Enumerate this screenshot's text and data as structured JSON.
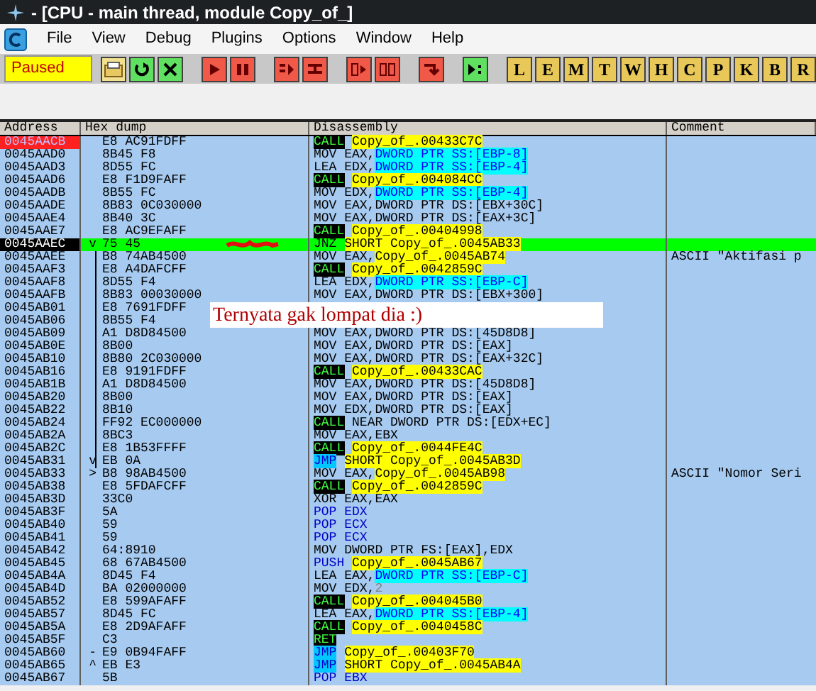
{
  "window": {
    "title": "- [CPU - main thread, module Copy_of_]"
  },
  "menu": [
    {
      "label": "File"
    },
    {
      "label": "View"
    },
    {
      "label": "Debug"
    },
    {
      "label": "Plugins"
    },
    {
      "label": "Options"
    },
    {
      "label": "Window"
    },
    {
      "label": "Help"
    }
  ],
  "toolbar": {
    "status": "Paused",
    "buttons": [
      {
        "kind": "open"
      },
      {
        "kind": "restart"
      },
      {
        "kind": "close"
      },
      {
        "kind": "run"
      },
      {
        "kind": "pause"
      },
      {
        "kind": "step_into"
      },
      {
        "kind": "step_over"
      },
      {
        "kind": "trace_into"
      },
      {
        "kind": "trace_over"
      },
      {
        "kind": "till_return"
      },
      {
        "kind": "go_to"
      },
      {
        "kind": "letter",
        "label": "L"
      },
      {
        "kind": "letter",
        "label": "E"
      },
      {
        "kind": "letter",
        "label": "M"
      },
      {
        "kind": "letter",
        "label": "T"
      },
      {
        "kind": "letter",
        "label": "W"
      },
      {
        "kind": "letter",
        "label": "H"
      },
      {
        "kind": "letter",
        "label": "C"
      },
      {
        "kind": "letter",
        "label": "P"
      },
      {
        "kind": "letter",
        "label": "K"
      },
      {
        "kind": "letter",
        "label": "B"
      },
      {
        "kind": "letter",
        "label": "R"
      }
    ]
  },
  "table": {
    "columns": [
      "Address",
      "Hex dump",
      "Disassembly",
      "Comment"
    ],
    "rows": [
      {
        "address": "0045AACB",
        "hex": "E8 AC91FDFF",
        "breakpoint": true,
        "selected": false,
        "op": {
          "text": "CALL",
          "kind": "call"
        },
        "args": [
          {
            "text": "Copy_of_.00433C7C",
            "kind": "target"
          }
        ]
      },
      {
        "address": "0045AAD0",
        "hex": "8B45 F8",
        "breakpoint": false,
        "selected": false,
        "op": {
          "text": "MOV",
          "kind": "plain"
        },
        "args": [
          {
            "text": "EAX,",
            "kind": "plain"
          },
          {
            "text": "DWORD PTR SS:[EBP-8]",
            "kind": "mem"
          }
        ]
      },
      {
        "address": "0045AAD3",
        "hex": "8D55 FC",
        "breakpoint": false,
        "selected": false,
        "op": {
          "text": "LEA",
          "kind": "plain"
        },
        "args": [
          {
            "text": "EDX,",
            "kind": "plain"
          },
          {
            "text": "DWORD PTR SS:[EBP-4]",
            "kind": "mem"
          }
        ]
      },
      {
        "address": "0045AAD6",
        "hex": "E8 F1D9FAFF",
        "breakpoint": false,
        "selected": false,
        "op": {
          "text": "CALL",
          "kind": "call"
        },
        "args": [
          {
            "text": "Copy_of_.004084CC",
            "kind": "target"
          }
        ]
      },
      {
        "address": "0045AADB",
        "hex": "8B55 FC",
        "breakpoint": false,
        "selected": false,
        "op": {
          "text": "MOV",
          "kind": "plain"
        },
        "args": [
          {
            "text": "EDX,",
            "kind": "plain"
          },
          {
            "text": "DWORD PTR SS:[EBP-4]",
            "kind": "mem"
          }
        ]
      },
      {
        "address": "0045AADE",
        "hex": "8B83 0C030000",
        "breakpoint": false,
        "selected": false,
        "op": {
          "text": "MOV",
          "kind": "plain"
        },
        "args": [
          {
            "text": "EAX,DWORD PTR DS:[EBX+30C]",
            "kind": "plain"
          }
        ]
      },
      {
        "address": "0045AAE4",
        "hex": "8B40 3C",
        "breakpoint": false,
        "selected": false,
        "op": {
          "text": "MOV",
          "kind": "plain"
        },
        "args": [
          {
            "text": "EAX,DWORD PTR DS:[EAX+3C]",
            "kind": "plain"
          }
        ]
      },
      {
        "address": "0045AAE7",
        "hex": "E8 AC9EFAFF",
        "breakpoint": false,
        "selected": false,
        "op": {
          "text": "CALL",
          "kind": "call"
        },
        "args": [
          {
            "text": "Copy_of_.00404998",
            "kind": "target"
          }
        ]
      },
      {
        "address": "0045AAEC",
        "hex": "75 45",
        "jump": "v",
        "breakpoint": false,
        "selected": true,
        "op": {
          "text": "JNZ",
          "kind": "plain"
        },
        "args": [
          {
            "text": "SHORT Copy_of_.0045AB33",
            "kind": "target"
          }
        ]
      },
      {
        "address": "0045AAEE",
        "hex": "B8 74AB4500",
        "jump_line": true,
        "breakpoint": false,
        "selected": false,
        "op": {
          "text": "MOV",
          "kind": "plain"
        },
        "args": [
          {
            "text": "EAX,",
            "kind": "plain"
          },
          {
            "text": "Copy_of_.0045AB74",
            "kind": "target"
          }
        ],
        "comment": "ASCII \"Aktifasi p"
      },
      {
        "address": "0045AAF3",
        "hex": "E8 A4DAFCFF",
        "jump_line": true,
        "breakpoint": false,
        "selected": false,
        "op": {
          "text": "CALL",
          "kind": "call"
        },
        "args": [
          {
            "text": "Copy_of_.0042859C",
            "kind": "target"
          }
        ]
      },
      {
        "address": "0045AAF8",
        "hex": "8D55 F4",
        "jump_line": true,
        "breakpoint": false,
        "selected": false,
        "op": {
          "text": "LEA",
          "kind": "plain"
        },
        "args": [
          {
            "text": "EDX,",
            "kind": "plain"
          },
          {
            "text": "DWORD PTR SS:[EBP-C]",
            "kind": "mem"
          }
        ]
      },
      {
        "address": "0045AAFB",
        "hex": "8B83 00030000",
        "jump_line": true,
        "breakpoint": false,
        "selected": false,
        "op": {
          "text": "MOV",
          "kind": "plain"
        },
        "args": [
          {
            "text": "EAX,DWORD PTR DS:[EBX+300]",
            "kind": "plain"
          }
        ]
      },
      {
        "address": "0045AB01",
        "hex": "E8 7691FDFF",
        "jump_line": true,
        "breakpoint": false,
        "selected": false
      },
      {
        "address": "0045AB06",
        "hex": "8B55 F4",
        "jump_line": true,
        "breakpoint": false,
        "selected": false
      },
      {
        "address": "0045AB09",
        "hex": "A1 D8D84500",
        "jump_line": true,
        "breakpoint": false,
        "selected": false,
        "op": {
          "text": "MOV",
          "kind": "plain"
        },
        "args": [
          {
            "text": "EAX,DWORD PTR DS:[45D8D8]",
            "kind": "plain"
          }
        ]
      },
      {
        "address": "0045AB0E",
        "hex": "8B00",
        "jump_line": true,
        "breakpoint": false,
        "selected": false,
        "op": {
          "text": "MOV",
          "kind": "plain"
        },
        "args": [
          {
            "text": "EAX,DWORD PTR DS:[EAX]",
            "kind": "plain"
          }
        ]
      },
      {
        "address": "0045AB10",
        "hex": "8B80 2C030000",
        "jump_line": true,
        "breakpoint": false,
        "selected": false,
        "op": {
          "text": "MOV",
          "kind": "plain"
        },
        "args": [
          {
            "text": "EAX,DWORD PTR DS:[EAX+32C]",
            "kind": "plain"
          }
        ]
      },
      {
        "address": "0045AB16",
        "hex": "E8 9191FDFF",
        "jump_line": true,
        "breakpoint": false,
        "selected": false,
        "op": {
          "text": "CALL",
          "kind": "call"
        },
        "args": [
          {
            "text": "Copy_of_.00433CAC",
            "kind": "target"
          }
        ]
      },
      {
        "address": "0045AB1B",
        "hex": "A1 D8D84500",
        "jump_line": true,
        "breakpoint": false,
        "selected": false,
        "op": {
          "text": "MOV",
          "kind": "plain"
        },
        "args": [
          {
            "text": "EAX,DWORD PTR DS:[45D8D8]",
            "kind": "plain"
          }
        ]
      },
      {
        "address": "0045AB20",
        "hex": "8B00",
        "jump_line": true,
        "breakpoint": false,
        "selected": false,
        "op": {
          "text": "MOV",
          "kind": "plain"
        },
        "args": [
          {
            "text": "EAX,DWORD PTR DS:[EAX]",
            "kind": "plain"
          }
        ]
      },
      {
        "address": "0045AB22",
        "hex": "8B10",
        "jump_line": true,
        "breakpoint": false,
        "selected": false,
        "op": {
          "text": "MOV",
          "kind": "plain"
        },
        "args": [
          {
            "text": "EDX,DWORD PTR DS:[EAX]",
            "kind": "plain"
          }
        ]
      },
      {
        "address": "0045AB24",
        "hex": "FF92 EC000000",
        "jump_line": true,
        "breakpoint": false,
        "selected": false,
        "op": {
          "text": "CALL",
          "kind": "call"
        },
        "args": [
          {
            "text": "NEAR DWORD PTR DS:[EDX+EC]",
            "kind": "plain"
          }
        ]
      },
      {
        "address": "0045AB2A",
        "hex": "8BC3",
        "jump_line": true,
        "breakpoint": false,
        "selected": false,
        "op": {
          "text": "MOV",
          "kind": "plain"
        },
        "args": [
          {
            "text": "EAX,EBX",
            "kind": "plain"
          }
        ]
      },
      {
        "address": "0045AB2C",
        "hex": "E8 1B53FFFF",
        "jump_line": true,
        "breakpoint": false,
        "selected": false,
        "op": {
          "text": "CALL",
          "kind": "call"
        },
        "args": [
          {
            "text": "Copy_of_.0044FE4C",
            "kind": "target"
          }
        ]
      },
      {
        "address": "0045AB31",
        "hex": "EB 0A",
        "jump": "v",
        "jump_line": true,
        "breakpoint": false,
        "selected": false,
        "op": {
          "text": "JMP",
          "kind": "jmp"
        },
        "args": [
          {
            "text": "SHORT Copy_of_.0045AB3D",
            "kind": "target"
          }
        ]
      },
      {
        "address": "0045AB33",
        "hex": "B8 98AB4500",
        "jump": ">",
        "breakpoint": false,
        "selected": false,
        "op": {
          "text": "MOV",
          "kind": "plain"
        },
        "args": [
          {
            "text": "EAX,",
            "kind": "plain"
          },
          {
            "text": "Copy_of_.0045AB98",
            "kind": "target"
          }
        ],
        "comment": "ASCII \"Nomor Seri"
      },
      {
        "address": "0045AB38",
        "hex": "E8 5FDAFCFF",
        "breakpoint": false,
        "selected": false,
        "op": {
          "text": "CALL",
          "kind": "call"
        },
        "args": [
          {
            "text": "Copy_of_.0042859C",
            "kind": "target"
          }
        ]
      },
      {
        "address": "0045AB3D",
        "hex": "33C0",
        "breakpoint": false,
        "selected": false,
        "op": {
          "text": "XOR",
          "kind": "plain"
        },
        "args": [
          {
            "text": "EAX,EAX",
            "kind": "plain"
          }
        ]
      },
      {
        "address": "0045AB3F",
        "hex": "5A",
        "breakpoint": false,
        "selected": false,
        "op": {
          "text": "POP",
          "kind": "stack"
        },
        "args": [
          {
            "text": "EDX",
            "kind": "stack"
          }
        ]
      },
      {
        "address": "0045AB40",
        "hex": "59",
        "breakpoint": false,
        "selected": false,
        "op": {
          "text": "POP",
          "kind": "stack"
        },
        "args": [
          {
            "text": "ECX",
            "kind": "stack"
          }
        ]
      },
      {
        "address": "0045AB41",
        "hex": "59",
        "breakpoint": false,
        "selected": false,
        "op": {
          "text": "POP",
          "kind": "stack"
        },
        "args": [
          {
            "text": "ECX",
            "kind": "stack"
          }
        ]
      },
      {
        "address": "0045AB42",
        "hex": "64:8910",
        "breakpoint": false,
        "selected": false,
        "op": {
          "text": "MOV",
          "kind": "plain"
        },
        "args": [
          {
            "text": "DWORD PTR FS:[EAX],EDX",
            "kind": "plain"
          }
        ]
      },
      {
        "address": "0045AB45",
        "hex": "68 67AB4500",
        "breakpoint": false,
        "selected": false,
        "op": {
          "text": "PUSH",
          "kind": "stack"
        },
        "args": [
          {
            "text": "Copy_of_.0045AB67",
            "kind": "target"
          }
        ]
      },
      {
        "address": "0045AB4A",
        "hex": "8D45 F4",
        "breakpoint": false,
        "selected": false,
        "op": {
          "text": "LEA",
          "kind": "plain"
        },
        "args": [
          {
            "text": "EAX,",
            "kind": "plain"
          },
          {
            "text": "DWORD PTR SS:[EBP-C]",
            "kind": "mem"
          }
        ]
      },
      {
        "address": "0045AB4D",
        "hex": "BA 02000000",
        "breakpoint": false,
        "selected": false,
        "op": {
          "text": "MOV",
          "kind": "plain"
        },
        "args": [
          {
            "text": "EDX,",
            "kind": "plain"
          },
          {
            "text": "2",
            "kind": "num"
          }
        ]
      },
      {
        "address": "0045AB52",
        "hex": "E8 599AFAFF",
        "breakpoint": false,
        "selected": false,
        "op": {
          "text": "CALL",
          "kind": "call"
        },
        "args": [
          {
            "text": "Copy_of_.004045B0",
            "kind": "target"
          }
        ]
      },
      {
        "address": "0045AB57",
        "hex": "8D45 FC",
        "breakpoint": false,
        "selected": false,
        "op": {
          "text": "LEA",
          "kind": "plain"
        },
        "args": [
          {
            "text": "EAX,",
            "kind": "plain"
          },
          {
            "text": "DWORD PTR SS:[EBP-4]",
            "kind": "mem"
          }
        ]
      },
      {
        "address": "0045AB5A",
        "hex": "E8 2D9AFAFF",
        "breakpoint": false,
        "selected": false,
        "op": {
          "text": "CALL",
          "kind": "call"
        },
        "args": [
          {
            "text": "Copy_of_.0040458C",
            "kind": "target"
          }
        ]
      },
      {
        "address": "0045AB5F",
        "hex": "C3",
        "breakpoint": false,
        "selected": false,
        "op": {
          "text": "RET",
          "kind": "call"
        }
      },
      {
        "address": "0045AB60",
        "hex": "E9 0B94FAFF",
        "jump": "-",
        "breakpoint": false,
        "selected": false,
        "op": {
          "text": "JMP",
          "kind": "jmp"
        },
        "args": [
          {
            "text": "Copy_of_.00403F70",
            "kind": "target"
          }
        ]
      },
      {
        "address": "0045AB65",
        "hex": "EB E3",
        "jump": "^",
        "breakpoint": false,
        "selected": false,
        "op": {
          "text": "JMP",
          "kind": "jmp"
        },
        "args": [
          {
            "text": "SHORT Copy_of_.0045AB4A",
            "kind": "target"
          }
        ]
      },
      {
        "address": "0045AB67",
        "hex": "5B",
        "breakpoint": false,
        "selected": false,
        "op": {
          "text": "POP",
          "kind": "stack"
        },
        "args": [
          {
            "text": "EBX",
            "kind": "stack"
          }
        ]
      }
    ]
  },
  "annotation": {
    "text": "Ternyata gak lompat dia :)"
  }
}
